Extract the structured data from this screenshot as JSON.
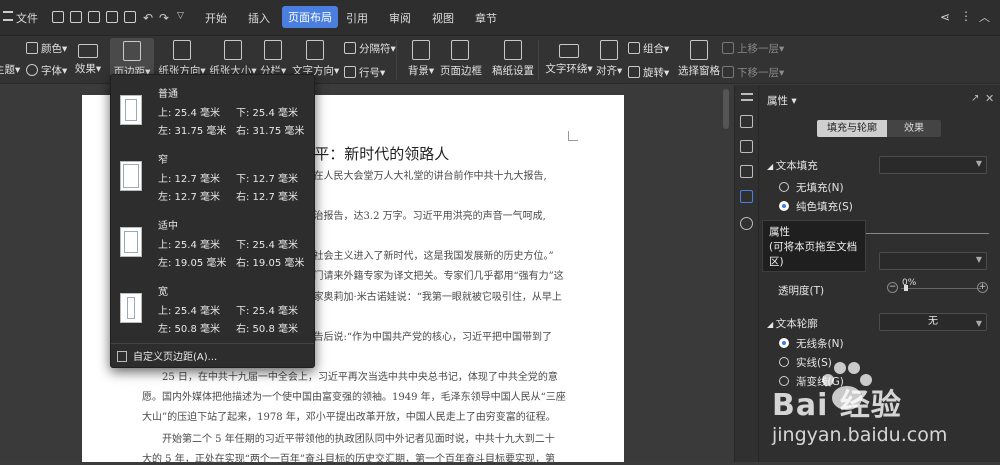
{
  "menubar": {
    "file": "文件",
    "tabs": [
      {
        "label": "开始"
      },
      {
        "label": "插入"
      },
      {
        "label": "页面布局"
      },
      {
        "label": "引用"
      },
      {
        "label": "审阅"
      },
      {
        "label": "视图"
      },
      {
        "label": "章节"
      }
    ]
  },
  "ribbon": {
    "theme": "主题",
    "color": "颜色",
    "font": "字体",
    "effect": "效果",
    "margins": "页边距",
    "orientation": "纸张方向",
    "size": "纸张大小",
    "columns": "分栏",
    "text_direction": "文字方向",
    "breaks": "分隔符",
    "line_numbers": "行号",
    "background": "背景",
    "page_border": "页面边框",
    "grid_setup": "稿纸设置",
    "wrap_text": "文字环绕",
    "align": "对齐",
    "rotate": "旋转",
    "group": "组合",
    "selection_pane": "选择窗格",
    "bring_forward": "上移一层",
    "send_backward": "下移一层"
  },
  "dropdown": {
    "options": [
      {
        "name": "普通",
        "top": "上: 25.4 毫米",
        "bottom": "下: 25.4 毫米",
        "left": "左: 31.75 毫米",
        "right": "右: 31.75 毫米"
      },
      {
        "name": "窄",
        "top": "上: 12.7 毫米",
        "bottom": "下: 12.7 毫米",
        "left": "左: 12.7 毫米",
        "right": "右: 12.7 毫米"
      },
      {
        "name": "适中",
        "top": "上: 25.4 毫米",
        "bottom": "下: 25.4 毫米",
        "left": "左: 19.05 毫米",
        "right": "右: 19.05 毫米"
      },
      {
        "name": "宽",
        "top": "上: 25.4 毫米",
        "bottom": "下: 25.4 毫米",
        "left": "左: 50.8 毫米",
        "right": "右: 50.8 毫米"
      }
    ],
    "custom": "自定义页边距(A)..."
  },
  "document": {
    "title": "...平：新时代的领路人",
    "lines": [
      "...在人民大会堂万人大礼堂的讲台前作中共十九大报告,",
      "...治报告，达3.2 万字。习近平用洪亮的声音一气呵成,",
      "...社会主义进入了新时代，这是我国发展新的历史方位。”",
      "...门请来外籍专家为译文把关。专家们几乎都用“强有力”这",
      "...家奥莉加·米古诺娃说：“我第一眼就被它吸引住，从早上",
      "...告后说:“作为中国共产党的核心，习近平把中国带到了",
      "25 日，在中共十九届一中全会上，习近平再次当选中共中央总书记，体现了中共全党的意",
      "愿。国内外媒体把他描述为一个使中国由富变强的领袖。1949 年，毛泽东领导中国人民从“三座",
      "大山”的压迫下站了起来，1978 年，邓小平提出改革开放，中国人民走上了由穷变富的征程。",
      "开始第二个 5 年任期的习近平带领他的执政团队同中外记者见面时说，中共十九大到二十",
      "大的 5 年，正处在实现“两个一百年”奋斗目标的历史交汇期，第一个百年奋斗目标要实现，第"
    ]
  },
  "panel": {
    "title": "属性",
    "tab_fill": "填充与轮廓",
    "tab_effect": "效果",
    "text_fill": "文本填充",
    "no_fill": "无填充(N)",
    "solid_fill": "纯色填充(S)",
    "transparency": "透明度(T)",
    "transparency_value": "0%",
    "text_outline": "文本轮廓",
    "outline_value": "无",
    "no_line": "无线条(N)",
    "solid_line": "实线(S)",
    "gradient_line": "渐变线(G)"
  },
  "tooltip": {
    "title": "属性",
    "desc1": "(可将本页拖至文档",
    "desc2": "区)"
  },
  "watermark": {
    "brand": "Bai 经验",
    "url": "jingyan.baidu.com"
  }
}
